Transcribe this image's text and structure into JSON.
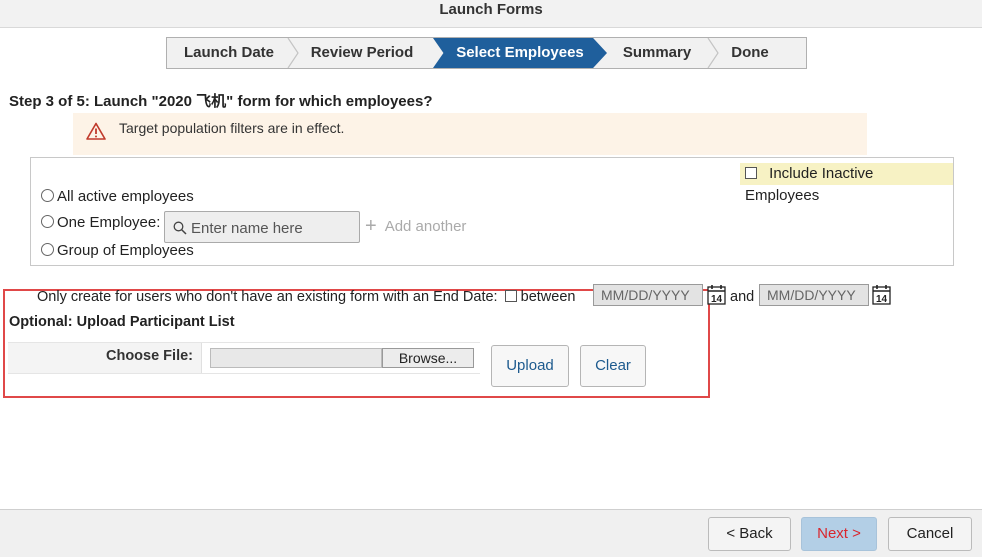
{
  "window": {
    "title": "Launch Forms"
  },
  "wizard": {
    "steps": [
      {
        "label": "Launch Date"
      },
      {
        "label": "Review Period"
      },
      {
        "label": "Select Employees"
      },
      {
        "label": "Summary"
      },
      {
        "label": "Done"
      }
    ],
    "active_step": "Select Employees"
  },
  "heading": "Step 3 of 5: Launch \"2020 飞机\" form for which employees?",
  "warning": {
    "icon": "warning-triangle-icon",
    "text": "Target population filters are in effect."
  },
  "selection": {
    "include_inactive_label": "Include Inactive Employees",
    "include_inactive_checked": false,
    "options": [
      {
        "label": "All active employees",
        "selected": false
      },
      {
        "label": "One Employee:",
        "selected": false
      },
      {
        "label": "Group of Employees",
        "selected": false
      }
    ],
    "name_input": {
      "placeholder": "Enter name here",
      "value": ""
    },
    "add_another_label": "Add another"
  },
  "end_date_filter": {
    "label": "Only create for users who don't have an existing form with an End Date:",
    "between_label": "between",
    "and_label": "and",
    "start_placeholder": "MM/DD/YYYY",
    "end_placeholder": "MM/DD/YYYY",
    "calendar_icon_text": "14"
  },
  "upload": {
    "title": "Optional: Upload Participant List",
    "choose_file_label": "Choose File:",
    "browse_label": "Browse...",
    "upload_label": "Upload",
    "clear_label": "Clear"
  },
  "footer": {
    "back_label": "< Back",
    "next_label": "Next >",
    "cancel_label": "Cancel"
  },
  "colors": {
    "active_step": "#1f5f9c",
    "warning_bg": "#fdf3e7",
    "highlight_box": "#e04848",
    "next_button_bg": "#b3cfe6",
    "next_button_text": "#d9262d"
  }
}
